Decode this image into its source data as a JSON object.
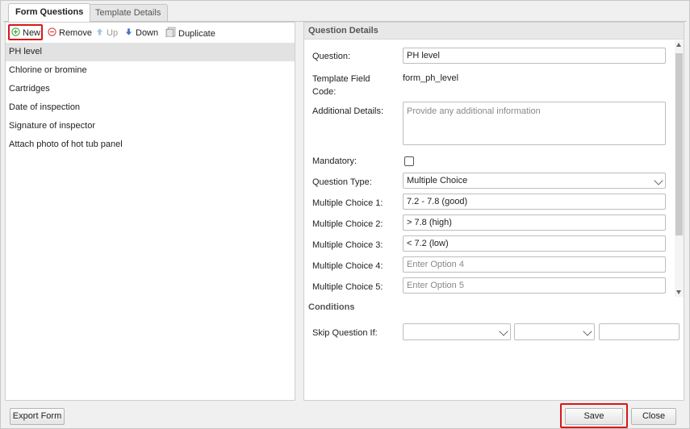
{
  "tabs": [
    {
      "label": "Form Questions",
      "active": true
    },
    {
      "label": "Template Details",
      "active": false
    }
  ],
  "toolbar": {
    "new_label": "New",
    "remove_label": "Remove",
    "up_label": "Up",
    "down_label": "Down",
    "duplicate_label": "Duplicate",
    "icons": [
      "plus-circle-icon",
      "minus-circle-icon",
      "arrow-up-icon",
      "arrow-down-icon",
      "duplicate-icon"
    ]
  },
  "questions": [
    {
      "label": "PH level",
      "selected": true
    },
    {
      "label": "Chlorine or bromine",
      "selected": false
    },
    {
      "label": "Cartridges",
      "selected": false
    },
    {
      "label": "Date of inspection",
      "selected": false
    },
    {
      "label": "Signature of inspector",
      "selected": false
    },
    {
      "label": "Attach photo of hot tub panel",
      "selected": false
    }
  ],
  "details": {
    "header": "Question Details",
    "question_label": "Question:",
    "question_value": "PH level",
    "field_code_label": "Template Field Code:",
    "field_code_value": "form_ph_level",
    "additional_label": "Additional Details:",
    "additional_placeholder": "Provide any additional information",
    "mandatory_label": "Mandatory:",
    "mandatory_checked": false,
    "type_label": "Question Type:",
    "type_value": "Multiple Choice",
    "choices": [
      {
        "label": "Multiple Choice 1:",
        "value": "7.2 - 7.8 (good)",
        "placeholder": ""
      },
      {
        "label": "Multiple Choice 2:",
        "value": "> 7.8 (high)",
        "placeholder": ""
      },
      {
        "label": "Multiple Choice 3:",
        "value": "< 7.2 (low)",
        "placeholder": ""
      },
      {
        "label": "Multiple Choice 4:",
        "value": "",
        "placeholder": "Enter Option 4"
      },
      {
        "label": "Multiple Choice 5:",
        "value": "",
        "placeholder": "Enter Option 5"
      }
    ]
  },
  "conditions": {
    "header": "Conditions",
    "skip_label": "Skip Question If:"
  },
  "footer": {
    "export_label": "Export Form",
    "save_label": "Save",
    "close_label": "Close"
  },
  "colors": {
    "highlight": "#d81818",
    "add_icon": "#3aa335",
    "remove_icon": "#d83a3a",
    "arrow_icon": "#3d78c8"
  }
}
